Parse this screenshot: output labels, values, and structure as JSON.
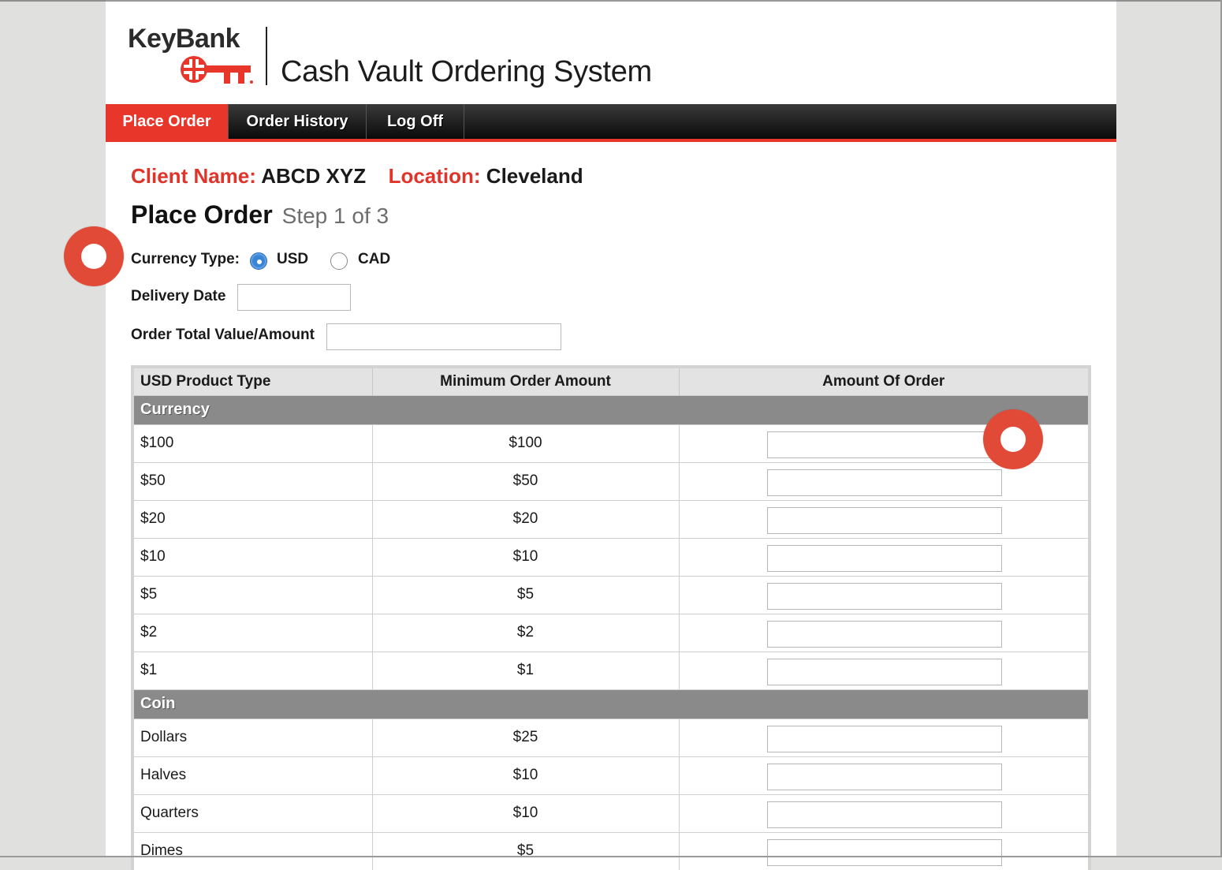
{
  "brand": {
    "logo_text": "KeyBank",
    "app_title": "Cash Vault Ordering System",
    "accent": "#e8372a"
  },
  "nav": {
    "items": [
      {
        "label": "Place Order",
        "active": true
      },
      {
        "label": "Order History",
        "active": false
      },
      {
        "label": "Log Off",
        "active": false
      }
    ]
  },
  "client": {
    "name_label": "Client Name:",
    "name_value": "ABCD XYZ",
    "location_label": "Location:",
    "location_value": "Cleveland"
  },
  "page": {
    "title": "Place Order",
    "step": "Step 1 of 3"
  },
  "form": {
    "currency_type_label": "Currency Type:",
    "currency_options": [
      {
        "label": "USD",
        "selected": true
      },
      {
        "label": "CAD",
        "selected": false
      }
    ],
    "delivery_date_label": "Delivery Date",
    "delivery_date_value": "",
    "order_total_label": "Order Total Value/Amount",
    "order_total_value": ""
  },
  "table": {
    "headers": [
      "USD Product Type",
      "Minimum Order Amount",
      "Amount Of Order"
    ],
    "sections": [
      {
        "name": "Currency",
        "rows": [
          {
            "product": "$100",
            "minimum": "$100",
            "amount": ""
          },
          {
            "product": "$50",
            "minimum": "$50",
            "amount": ""
          },
          {
            "product": "$20",
            "minimum": "$20",
            "amount": ""
          },
          {
            "product": "$10",
            "minimum": "$10",
            "amount": ""
          },
          {
            "product": "$5",
            "minimum": "$5",
            "amount": ""
          },
          {
            "product": "$2",
            "minimum": "$2",
            "amount": ""
          },
          {
            "product": "$1",
            "minimum": "$1",
            "amount": ""
          }
        ]
      },
      {
        "name": "Coin",
        "rows": [
          {
            "product": "Dollars",
            "minimum": "$25",
            "amount": ""
          },
          {
            "product": "Halves",
            "minimum": "$10",
            "amount": ""
          },
          {
            "product": "Quarters",
            "minimum": "$10",
            "amount": ""
          },
          {
            "product": "Dimes",
            "minimum": "$5",
            "amount": ""
          }
        ]
      }
    ]
  }
}
